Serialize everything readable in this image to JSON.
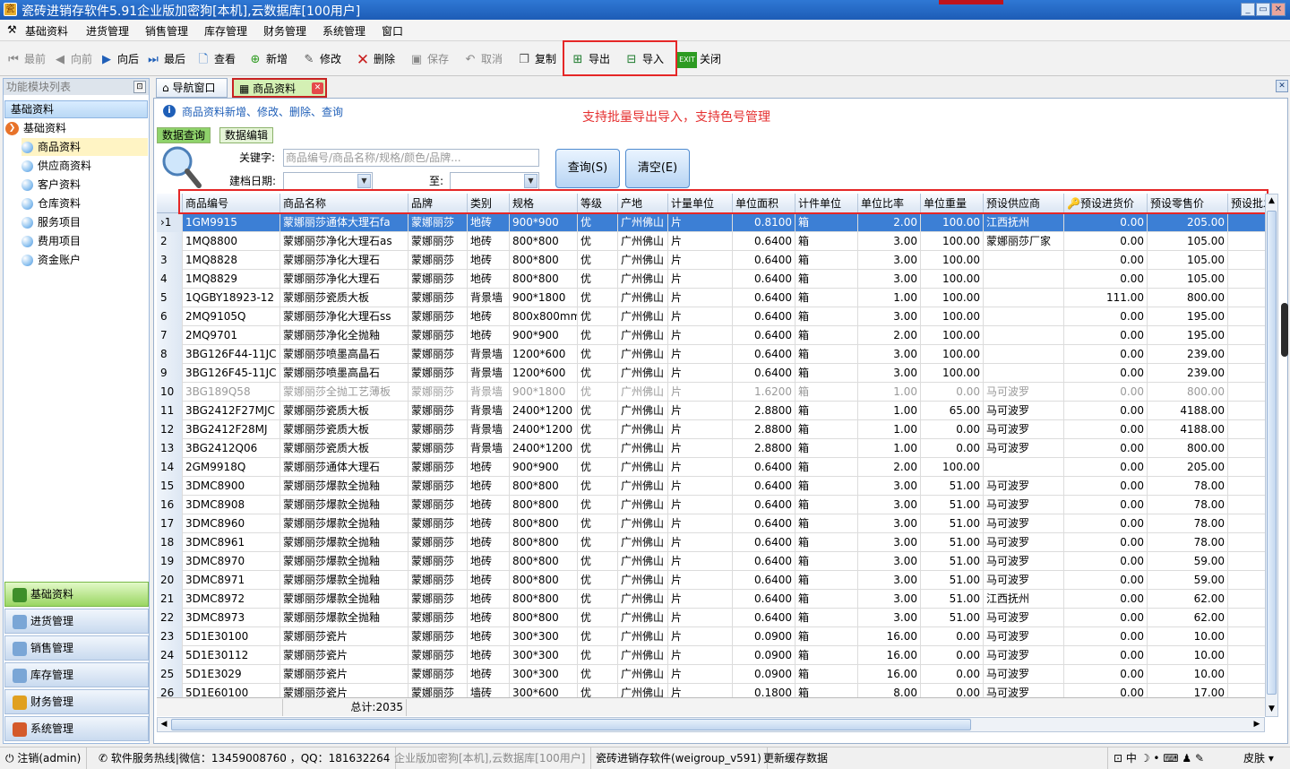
{
  "window": {
    "title": "瓷砖进销存软件5.91企业版加密狗[本机],云数据库[100用户]",
    "icon": "app-icon"
  },
  "menu": [
    "基础资料",
    "进货管理",
    "销售管理",
    "库存管理",
    "财务管理",
    "系统管理",
    "窗口"
  ],
  "toolbar": [
    {
      "label": "最前",
      "icon": "first-icon",
      "enabled": false
    },
    {
      "label": "向前",
      "icon": "prev-icon",
      "enabled": false
    },
    {
      "label": "向后",
      "icon": "next-icon",
      "enabled": true
    },
    {
      "label": "最后",
      "icon": "last-icon",
      "enabled": true
    },
    {
      "label": "查看",
      "icon": "view-icon",
      "enabled": true
    },
    {
      "label": "新增",
      "icon": "add-icon",
      "enabled": true
    },
    {
      "label": "修改",
      "icon": "edit-icon",
      "enabled": true
    },
    {
      "label": "删除",
      "icon": "delete-icon",
      "enabled": true
    },
    {
      "label": "保存",
      "icon": "save-icon",
      "enabled": false
    },
    {
      "label": "取消",
      "icon": "cancel-icon",
      "enabled": false
    },
    {
      "label": "复制",
      "icon": "copy-icon",
      "enabled": true
    },
    {
      "label": "导出",
      "icon": "export-icon",
      "enabled": true
    },
    {
      "label": "导入",
      "icon": "import-icon",
      "enabled": true
    },
    {
      "label": "关闭",
      "icon": "exit-icon",
      "enabled": true
    }
  ],
  "exit_badge": "EXIT",
  "left": {
    "header": "功能模块列表",
    "group": "基础资料",
    "node": "基础资料",
    "items": [
      "商品资料",
      "供应商资料",
      "客户资料",
      "仓库资料",
      "服务项目",
      "费用项目",
      "资金账户"
    ],
    "nav": [
      "基础资料",
      "进货管理",
      "销售管理",
      "库存管理",
      "财务管理",
      "系统管理"
    ]
  },
  "tabs": [
    "导航窗口",
    "商品资料"
  ],
  "ops": "商品资料新增、修改、删除、查询",
  "promo": "支持批量导出导入，支持色号管理",
  "subtabs": [
    "数据查询",
    "数据编辑"
  ],
  "search": {
    "keyword_label": "关键字:",
    "keyword_placeholder": "商品编号/商品名称/规格/颜色/品牌...",
    "date_label": "建档日期:",
    "to_label": "至:",
    "query_btn": "查询(S)",
    "clear_btn": "清空(E)"
  },
  "columns": [
    "商品编号",
    "商品名称",
    "品牌",
    "类别",
    "规格",
    "等级",
    "产地",
    "计量单位",
    "单位面积",
    "计件单位",
    "单位比率",
    "单位重量",
    "预设供应商",
    "预设进货价",
    "预设零售价",
    "预设批发"
  ],
  "rows": [
    [
      "1",
      "1GM9915",
      "蒙娜丽莎通体大理石fa",
      "蒙娜丽莎",
      "地砖",
      "900*900",
      "优",
      "广州佛山",
      "片",
      "0.8100",
      "箱",
      "2.00",
      "100.00",
      "江西抚州",
      "0.00",
      "205.00"
    ],
    [
      "2",
      "1MQ8800",
      "蒙娜丽莎净化大理石as",
      "蒙娜丽莎",
      "地砖",
      "800*800",
      "优",
      "广州佛山",
      "片",
      "0.6400",
      "箱",
      "3.00",
      "100.00",
      "蒙娜丽莎厂家",
      "0.00",
      "105.00"
    ],
    [
      "3",
      "1MQ8828",
      "蒙娜丽莎净化大理石",
      "蒙娜丽莎",
      "地砖",
      "800*800",
      "优",
      "广州佛山",
      "片",
      "0.6400",
      "箱",
      "3.00",
      "100.00",
      "",
      "0.00",
      "105.00"
    ],
    [
      "4",
      "1MQ8829",
      "蒙娜丽莎净化大理石",
      "蒙娜丽莎",
      "地砖",
      "800*800",
      "优",
      "广州佛山",
      "片",
      "0.6400",
      "箱",
      "3.00",
      "100.00",
      "",
      "0.00",
      "105.00"
    ],
    [
      "5",
      "1QGBY18923-12",
      "蒙娜丽莎瓷质大板",
      "蒙娜丽莎",
      "背景墙",
      "900*1800",
      "优",
      "广州佛山",
      "片",
      "0.6400",
      "箱",
      "1.00",
      "100.00",
      "",
      "111.00",
      "800.00"
    ],
    [
      "6",
      "2MQ9105Q",
      "蒙娜丽莎净化大理石ss",
      "蒙娜丽莎",
      "地砖",
      "800x800mm",
      "优",
      "广州佛山",
      "片",
      "0.6400",
      "箱",
      "3.00",
      "100.00",
      "",
      "0.00",
      "195.00"
    ],
    [
      "7",
      "2MQ9701",
      "蒙娜丽莎净化全抛釉",
      "蒙娜丽莎",
      "地砖",
      "900*900",
      "优",
      "广州佛山",
      "片",
      "0.6400",
      "箱",
      "2.00",
      "100.00",
      "",
      "0.00",
      "195.00"
    ],
    [
      "8",
      "3BG126F44-11JC",
      "蒙娜丽莎喷墨高晶石",
      "蒙娜丽莎",
      "背景墙",
      "1200*600",
      "优",
      "广州佛山",
      "片",
      "0.6400",
      "箱",
      "3.00",
      "100.00",
      "",
      "0.00",
      "239.00"
    ],
    [
      "9",
      "3BG126F45-11JC",
      "蒙娜丽莎喷墨高晶石",
      "蒙娜丽莎",
      "背景墙",
      "1200*600",
      "优",
      "广州佛山",
      "片",
      "0.6400",
      "箱",
      "3.00",
      "100.00",
      "",
      "0.00",
      "239.00"
    ],
    [
      "10",
      "3BG189Q58",
      "蒙娜丽莎全抛工艺薄板",
      "蒙娜丽莎",
      "背景墙",
      "900*1800",
      "优",
      "广州佛山",
      "片",
      "1.6200",
      "箱",
      "1.00",
      "0.00",
      "马可波罗",
      "0.00",
      "800.00"
    ],
    [
      "11",
      "3BG2412F27MJC",
      "蒙娜丽莎瓷质大板",
      "蒙娜丽莎",
      "背景墙",
      "2400*1200",
      "优",
      "广州佛山",
      "片",
      "2.8800",
      "箱",
      "1.00",
      "65.00",
      "马可波罗",
      "0.00",
      "4188.00"
    ],
    [
      "12",
      "3BG2412F28MJ",
      "蒙娜丽莎瓷质大板",
      "蒙娜丽莎",
      "背景墙",
      "2400*1200",
      "优",
      "广州佛山",
      "片",
      "2.8800",
      "箱",
      "1.00",
      "0.00",
      "马可波罗",
      "0.00",
      "4188.00"
    ],
    [
      "13",
      "3BG2412Q06",
      "蒙娜丽莎瓷质大板",
      "蒙娜丽莎",
      "背景墙",
      "2400*1200",
      "优",
      "广州佛山",
      "片",
      "2.8800",
      "箱",
      "1.00",
      "0.00",
      "马可波罗",
      "0.00",
      "800.00"
    ],
    [
      "14",
      "2GM9918Q",
      "蒙娜丽莎通体大理石",
      "蒙娜丽莎",
      "地砖",
      "900*900",
      "优",
      "广州佛山",
      "片",
      "0.6400",
      "箱",
      "2.00",
      "100.00",
      "",
      "0.00",
      "205.00"
    ],
    [
      "15",
      "3DMC8900",
      "蒙娜丽莎爆款全抛釉",
      "蒙娜丽莎",
      "地砖",
      "800*800",
      "优",
      "广州佛山",
      "片",
      "0.6400",
      "箱",
      "3.00",
      "51.00",
      "马可波罗",
      "0.00",
      "78.00"
    ],
    [
      "16",
      "3DMC8908",
      "蒙娜丽莎爆款全抛釉",
      "蒙娜丽莎",
      "地砖",
      "800*800",
      "优",
      "广州佛山",
      "片",
      "0.6400",
      "箱",
      "3.00",
      "51.00",
      "马可波罗",
      "0.00",
      "78.00"
    ],
    [
      "17",
      "3DMC8960",
      "蒙娜丽莎爆款全抛釉",
      "蒙娜丽莎",
      "地砖",
      "800*800",
      "优",
      "广州佛山",
      "片",
      "0.6400",
      "箱",
      "3.00",
      "51.00",
      "马可波罗",
      "0.00",
      "78.00"
    ],
    [
      "18",
      "3DMC8961",
      "蒙娜丽莎爆款全抛釉",
      "蒙娜丽莎",
      "地砖",
      "800*800",
      "优",
      "广州佛山",
      "片",
      "0.6400",
      "箱",
      "3.00",
      "51.00",
      "马可波罗",
      "0.00",
      "78.00"
    ],
    [
      "19",
      "3DMC8970",
      "蒙娜丽莎爆款全抛釉",
      "蒙娜丽莎",
      "地砖",
      "800*800",
      "优",
      "广州佛山",
      "片",
      "0.6400",
      "箱",
      "3.00",
      "51.00",
      "马可波罗",
      "0.00",
      "59.00"
    ],
    [
      "20",
      "3DMC8971",
      "蒙娜丽莎爆款全抛釉",
      "蒙娜丽莎",
      "地砖",
      "800*800",
      "优",
      "广州佛山",
      "片",
      "0.6400",
      "箱",
      "3.00",
      "51.00",
      "马可波罗",
      "0.00",
      "59.00"
    ],
    [
      "21",
      "3DMC8972",
      "蒙娜丽莎爆款全抛釉",
      "蒙娜丽莎",
      "地砖",
      "800*800",
      "优",
      "广州佛山",
      "片",
      "0.6400",
      "箱",
      "3.00",
      "51.00",
      "江西抚州",
      "0.00",
      "62.00"
    ],
    [
      "22",
      "3DMC8973",
      "蒙娜丽莎爆款全抛釉",
      "蒙娜丽莎",
      "地砖",
      "800*800",
      "优",
      "广州佛山",
      "片",
      "0.6400",
      "箱",
      "3.00",
      "51.00",
      "马可波罗",
      "0.00",
      "62.00"
    ],
    [
      "23",
      "5D1E30100",
      "蒙娜丽莎瓷片",
      "蒙娜丽莎",
      "地砖",
      "300*300",
      "优",
      "广州佛山",
      "片",
      "0.0900",
      "箱",
      "16.00",
      "0.00",
      "马可波罗",
      "0.00",
      "10.00"
    ],
    [
      "24",
      "5D1E30112",
      "蒙娜丽莎瓷片",
      "蒙娜丽莎",
      "地砖",
      "300*300",
      "优",
      "广州佛山",
      "片",
      "0.0900",
      "箱",
      "16.00",
      "0.00",
      "马可波罗",
      "0.00",
      "10.00"
    ],
    [
      "25",
      "5D1E3029",
      "蒙娜丽莎瓷片",
      "蒙娜丽莎",
      "地砖",
      "300*300",
      "优",
      "广州佛山",
      "片",
      "0.0900",
      "箱",
      "16.00",
      "0.00",
      "马可波罗",
      "0.00",
      "10.00"
    ],
    [
      "26",
      "5D1E60100",
      "蒙娜丽莎瓷片",
      "蒙娜丽莎",
      "墙砖",
      "300*600",
      "优",
      "广州佛山",
      "片",
      "0.1800",
      "箱",
      "8.00",
      "0.00",
      "马可波罗",
      "0.00",
      "17.00"
    ]
  ],
  "footer_total": "总计:2035",
  "status": {
    "logout": "注销(admin)",
    "hotline": "软件服务热线|微信：13459008760 ，QQ：181632264",
    "edition": "企业版加密狗[本机],云数据库[100用户]",
    "product": "瓷砖进销存软件(weigroup_v591)",
    "cache": "更新缓存数据",
    "ime_lang": "中",
    "skin": "皮肤"
  }
}
